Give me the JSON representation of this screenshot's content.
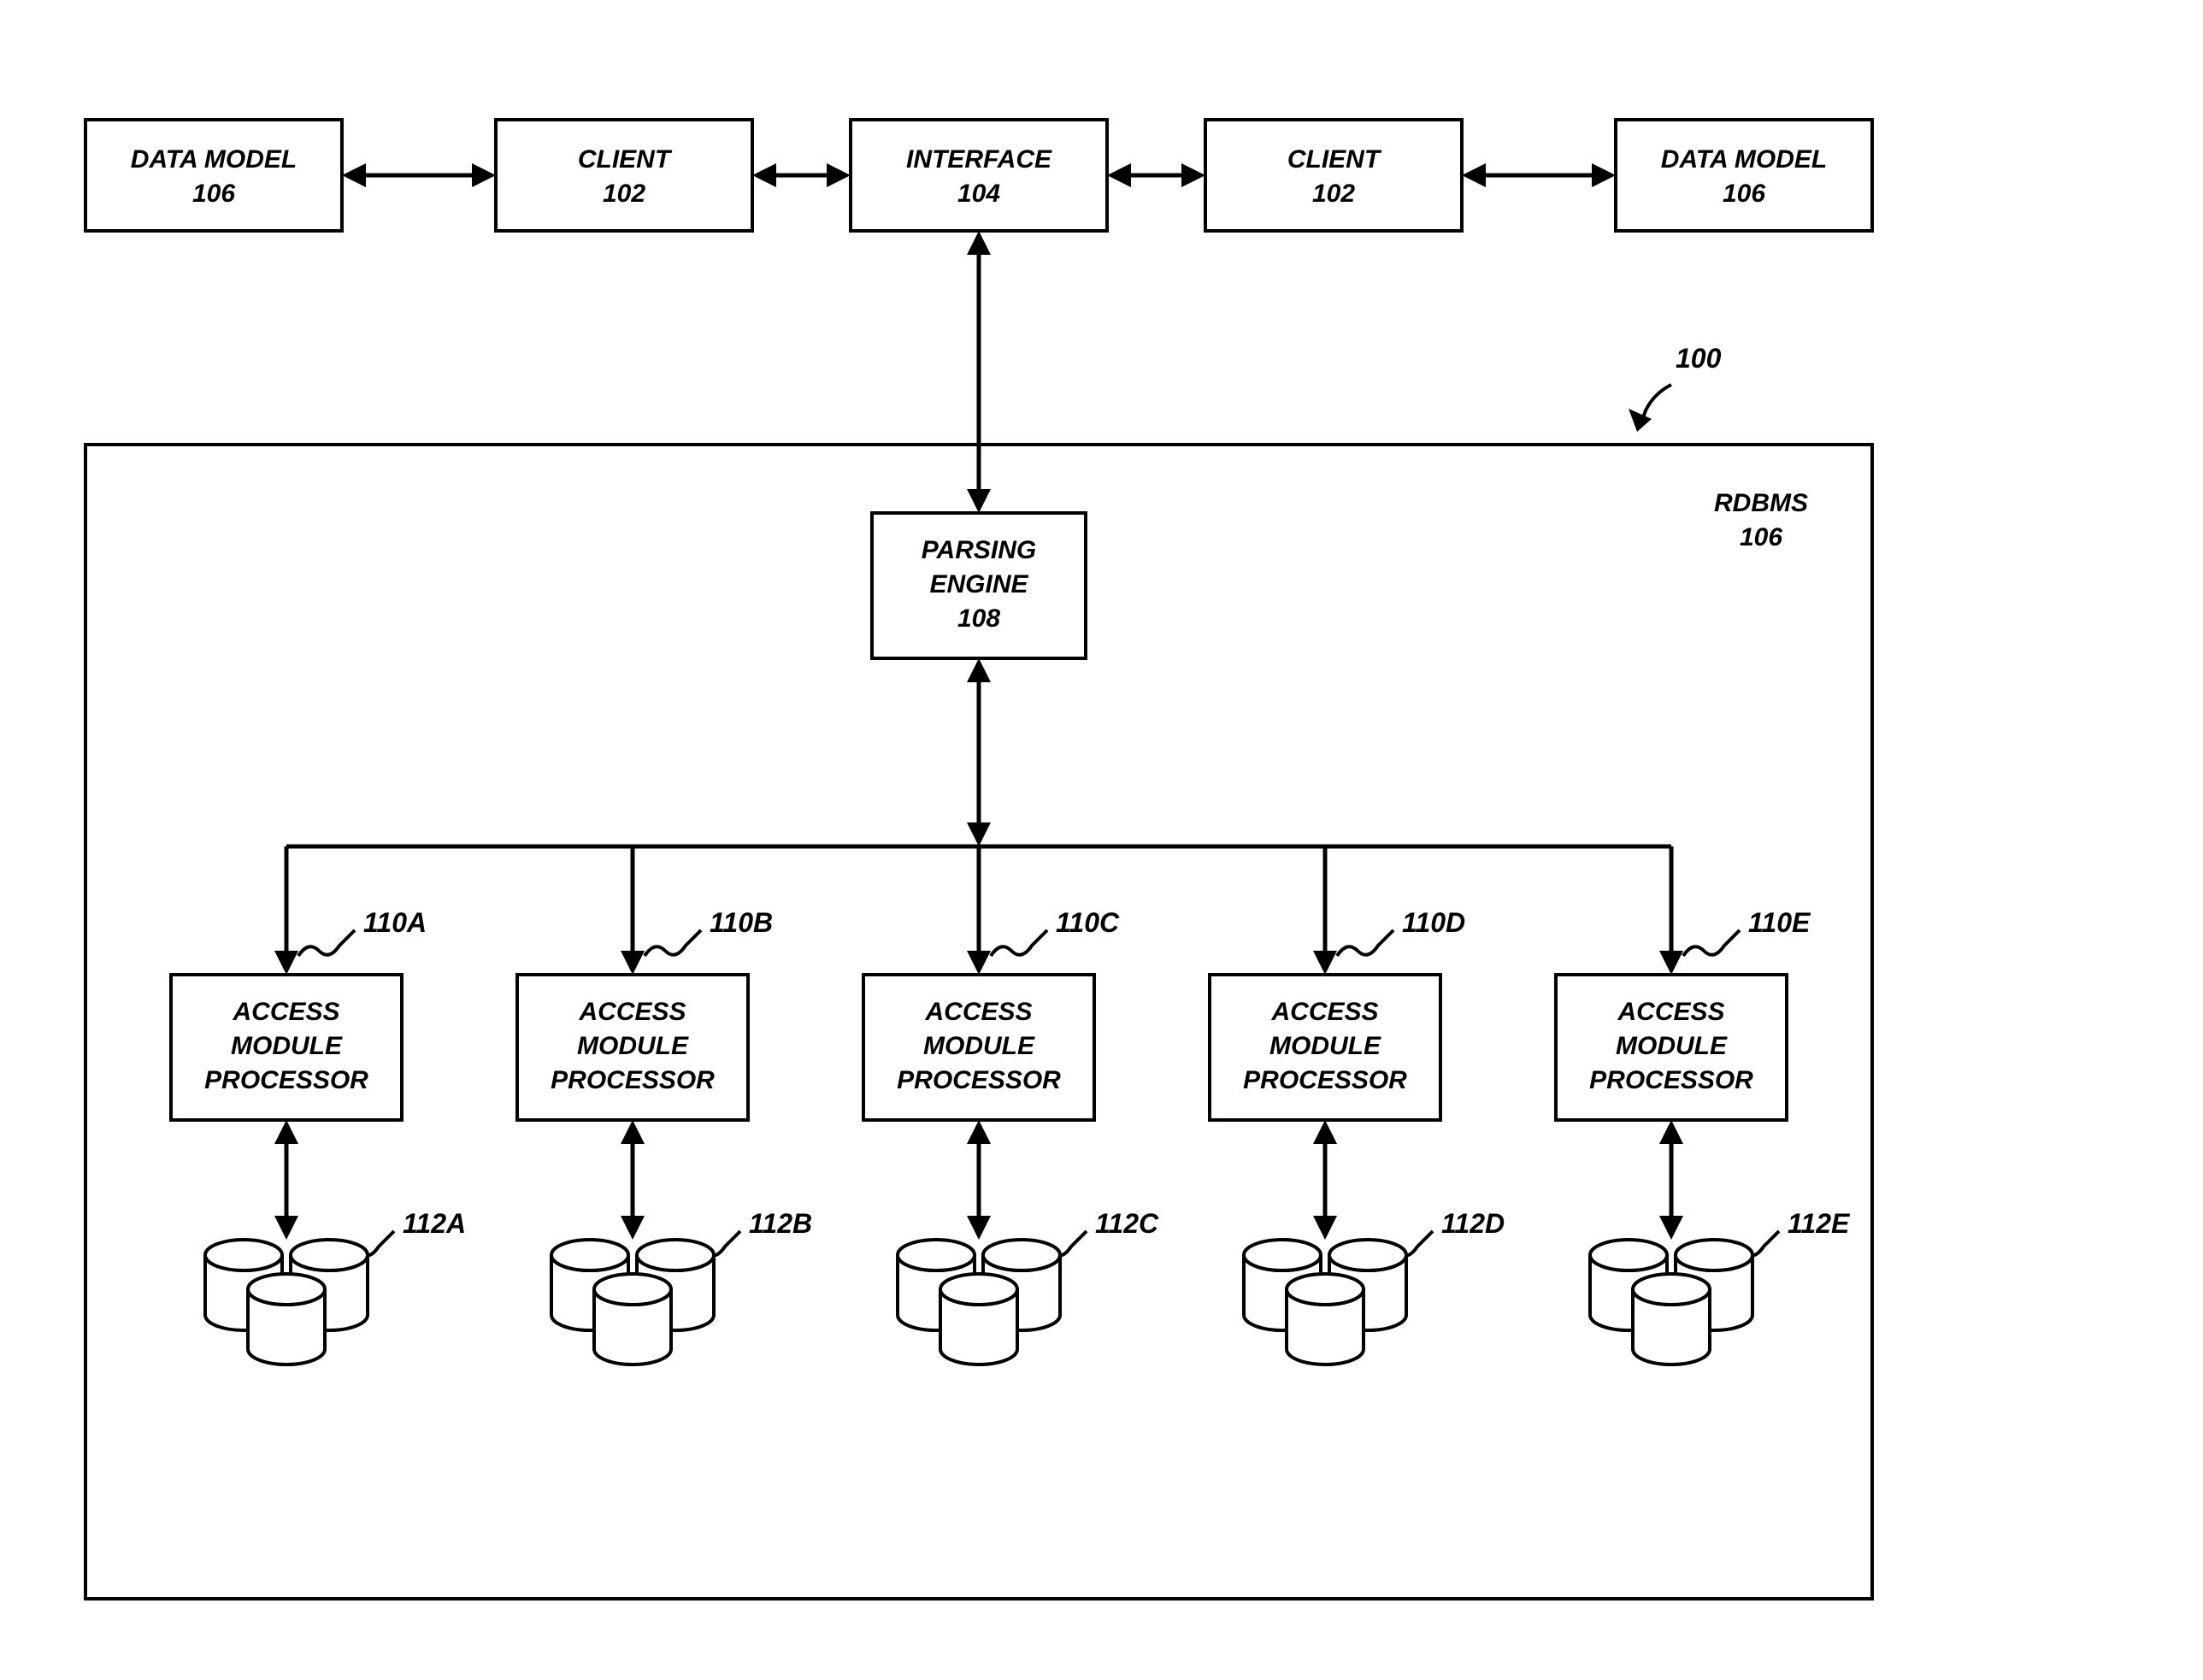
{
  "topRow": {
    "dataModelLeft": {
      "line1": "DATA MODEL",
      "line2": "106"
    },
    "clientLeft": {
      "line1": "CLIENT",
      "line2": "102"
    },
    "interface": {
      "line1": "INTERFACE",
      "line2": "104"
    },
    "clientRight": {
      "line1": "CLIENT",
      "line2": "102"
    },
    "dataModelRight": {
      "line1": "DATA MODEL",
      "line2": "106"
    }
  },
  "systemRef": "100",
  "rdbms": {
    "title": "RDBMS",
    "ref": "106"
  },
  "parsingEngine": {
    "line1": "PARSING",
    "line2": "ENGINE",
    "line3": "108"
  },
  "amp": {
    "labelLine1": "ACCESS",
    "labelLine2": "MODULE",
    "labelLine3": "PROCESSOR",
    "units": [
      {
        "ampRef": "110A",
        "dbRef": "112A"
      },
      {
        "ampRef": "110B",
        "dbRef": "112B"
      },
      {
        "ampRef": "110C",
        "dbRef": "112C"
      },
      {
        "ampRef": "110D",
        "dbRef": "112D"
      },
      {
        "ampRef": "110E",
        "dbRef": "112E"
      }
    ]
  }
}
